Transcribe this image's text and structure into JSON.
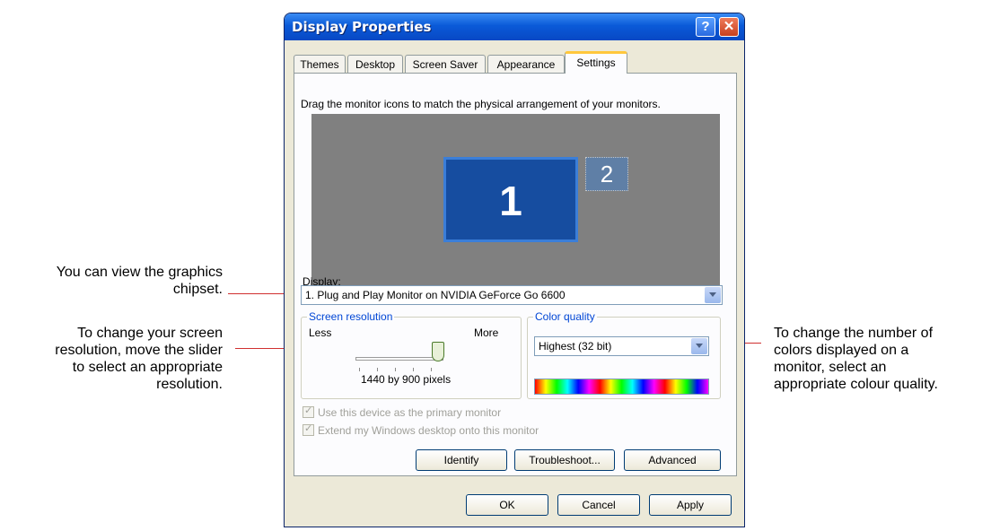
{
  "annotations": {
    "graphics": [
      "You can view the graphics",
      "chipset."
    ],
    "resolution": [
      "To change your screen",
      "resolution, move the slider",
      "to select an appropriate",
      "resolution."
    ],
    "color": [
      "To change the number of",
      "colors displayed on a",
      "monitor, select an",
      "appropriate colour quality."
    ]
  },
  "window": {
    "title": "Display Properties",
    "help_label": "?",
    "close_label": "✕"
  },
  "tabs": [
    {
      "label": "Themes"
    },
    {
      "label": "Desktop"
    },
    {
      "label": "Screen Saver"
    },
    {
      "label": "Appearance"
    },
    {
      "label": "Settings"
    }
  ],
  "settings": {
    "instruction": "Drag the monitor icons to match the physical arrangement of your monitors.",
    "monitors": [
      {
        "number": "1",
        "selected": true
      },
      {
        "number": "2",
        "selected": false
      }
    ],
    "display_label": "Display:",
    "display_value": "1. Plug and Play Monitor on NVIDIA GeForce Go 6600",
    "resolution": {
      "group_label": "Screen resolution",
      "less": "Less",
      "more": "More",
      "value_text": "1440 by 900 pixels",
      "slider_fraction": 1.0
    },
    "color_quality": {
      "group_label": "Color quality",
      "value": "Highest (32 bit)"
    },
    "checkboxes": [
      {
        "label": "Use this device as the primary monitor",
        "checked": true,
        "enabled": false
      },
      {
        "label": "Extend my Windows desktop onto this monitor",
        "checked": true,
        "enabled": false
      }
    ],
    "buttons": {
      "identify": "Identify",
      "troubleshoot": "Troubleshoot...",
      "advanced": "Advanced"
    }
  },
  "footer": {
    "ok": "OK",
    "cancel": "Cancel",
    "apply": "Apply"
  },
  "colors": {
    "title_bar": "#0a5ad8",
    "monitor_selected": "#164da0",
    "leader_line": "#d03030"
  }
}
